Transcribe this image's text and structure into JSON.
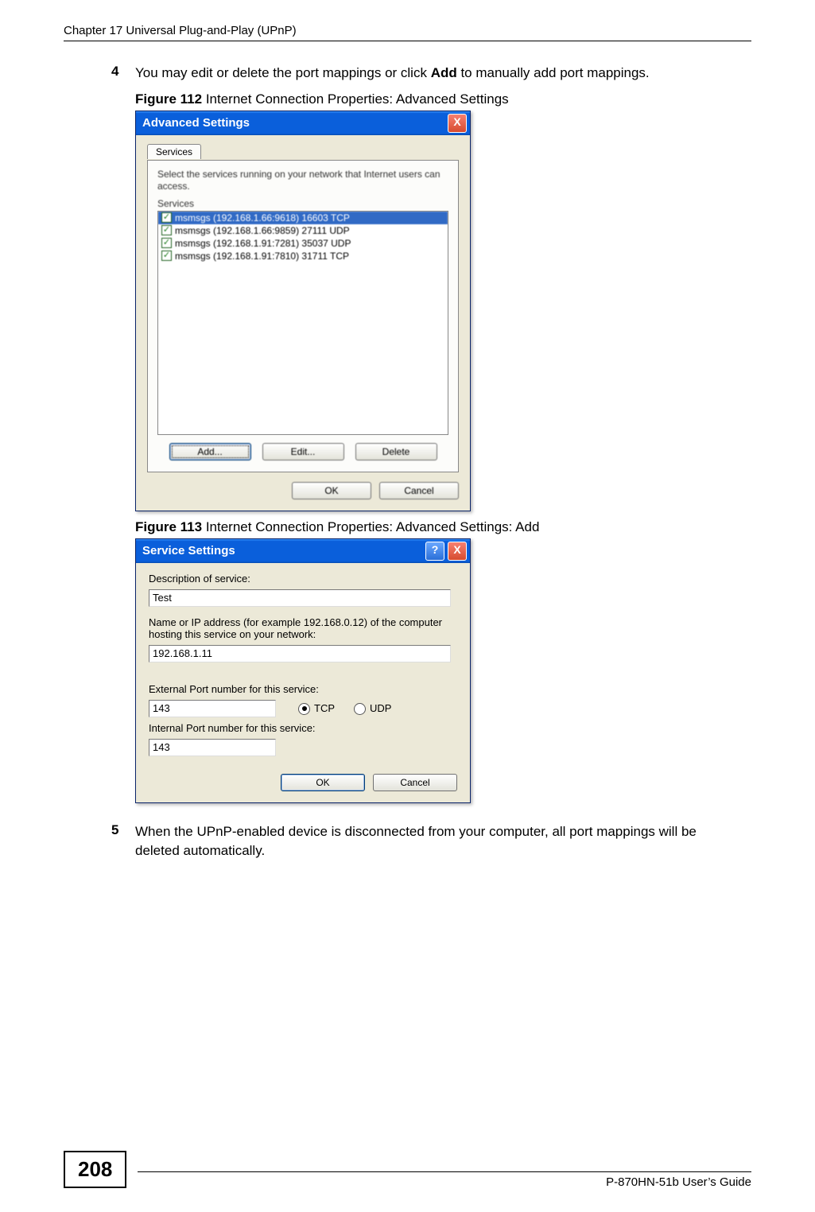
{
  "header": {
    "chapter": "Chapter 17 Universal Plug-and-Play (UPnP)"
  },
  "steps": {
    "s4": {
      "num": "4",
      "text_pre": "You may edit or delete the port mappings or click ",
      "bold": "Add",
      "text_post": " to manually add port mappings."
    },
    "s5": {
      "num": "5",
      "text": "When the UPnP-enabled device is disconnected from your computer, all port mappings will be deleted automatically."
    }
  },
  "figures": {
    "f112": {
      "label": "Figure 112   ",
      "caption": "Internet Connection Properties: Advanced Settings"
    },
    "f113": {
      "label": "Figure 113   ",
      "caption": "Internet Connection Properties: Advanced Settings: Add"
    }
  },
  "adv": {
    "title": "Advanced Settings",
    "tab": "Services",
    "instr": "Select the services running on your network that Internet users can access.",
    "services_label": "Services",
    "items": [
      "msmsgs (192.168.1.66:9618) 16603 TCP",
      "msmsgs (192.168.1.66:9859) 27111 UDP",
      "msmsgs (192.168.1.91:7281) 35037 UDP",
      "msmsgs (192.168.1.91:7810) 31711 TCP"
    ],
    "buttons": {
      "add": "Add...",
      "edit": "Edit...",
      "delete": "Delete",
      "ok": "OK",
      "cancel": "Cancel"
    },
    "close": "X"
  },
  "svc": {
    "title": "Service Settings",
    "help": "?",
    "close": "X",
    "l_desc": "Description of service:",
    "v_desc": "Test",
    "l_host": "Name or IP address (for example 192.168.0.12) of the computer hosting this service on your network:",
    "v_host": "192.168.1.11",
    "l_ext": "External Port number for this service:",
    "v_ext": "143",
    "r_tcp": "TCP",
    "r_udp": "UDP",
    "l_int": "Internal Port number for this service:",
    "v_int": "143",
    "ok": "OK",
    "cancel": "Cancel"
  },
  "footer": {
    "page": "208",
    "guide": "P-870HN-51b User’s Guide"
  }
}
